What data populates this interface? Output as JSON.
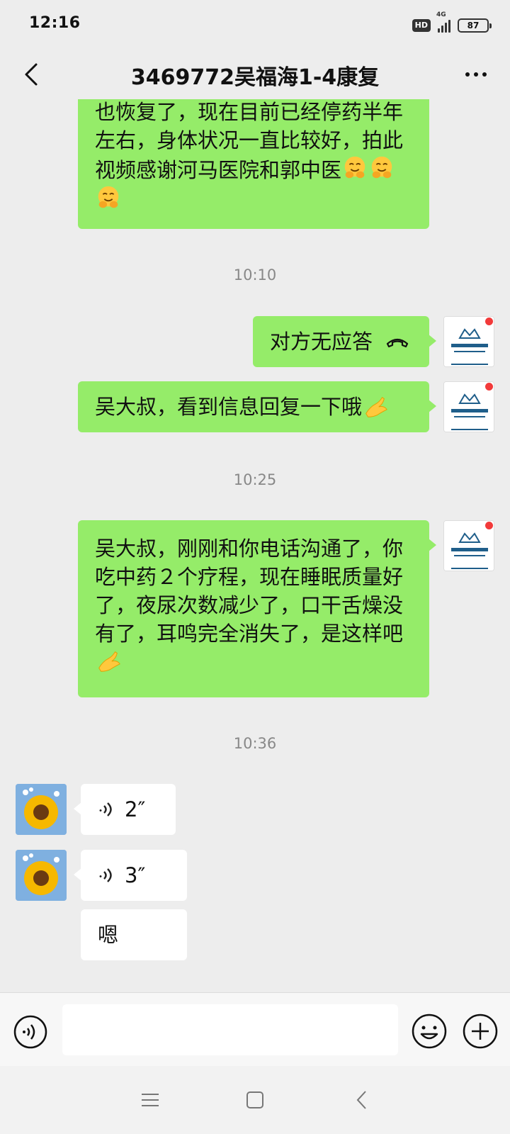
{
  "status_bar": {
    "time": "12:16",
    "hd": "HD",
    "network": "4G",
    "battery": "87"
  },
  "header": {
    "title": "3469772吴福海1-4康复"
  },
  "messages": [
    {
      "side": "right",
      "lines": [
        "也恢复了，现在目前已经停药半年",
        "左右，身体状况一直比较好，拍此",
        "视频感谢河马医院和郭中医"
      ]
    },
    {
      "type": "time",
      "text": "10:10"
    },
    {
      "side": "right",
      "call_text": "对方无应答"
    },
    {
      "side": "right",
      "text": "吴大叔，看到信息回复一下哦"
    },
    {
      "type": "time",
      "text": "10:25"
    },
    {
      "side": "right",
      "lines": [
        "吴大叔，刚刚和你电话沟通了，你",
        "吃中药２个疗程，现在睡眠质量好",
        "了，夜尿次数减少了，口干舌燥没",
        "有了，耳鸣完全消失了，是这样吧"
      ]
    },
    {
      "type": "time",
      "text": "10:36"
    },
    {
      "side": "left",
      "voice_duration": "2″"
    },
    {
      "side": "left",
      "voice_duration": "3″"
    },
    {
      "side": "left",
      "text": "嗯"
    }
  ],
  "icons": {
    "emoji_hug": "hugging-face-emoji",
    "emoji_ok": "ok-hand-emoji",
    "call_end": "phone-hangup-icon",
    "voice": "voice-wave-icon"
  },
  "colors": {
    "sent_bubble": "#95ec69",
    "received_bubble": "#ffffff",
    "background": "#ededed",
    "unread_dot": "#f23a3a"
  }
}
